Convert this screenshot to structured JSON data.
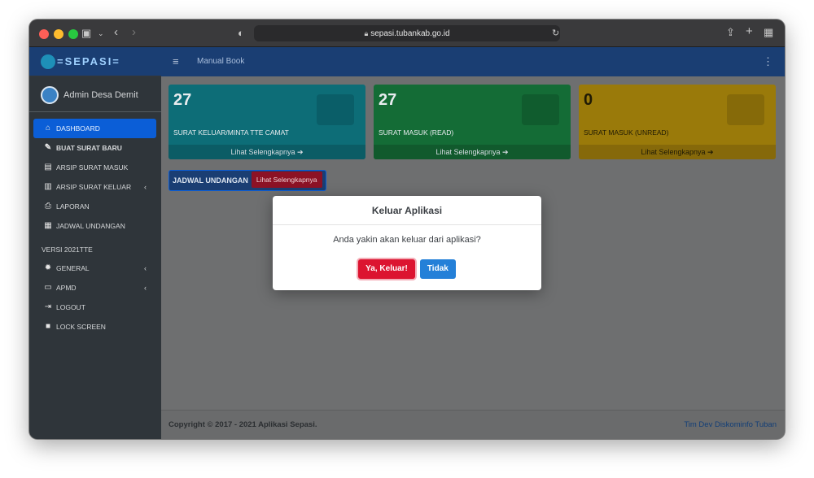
{
  "browser": {
    "url": "sepasi.tubankab.go.id"
  },
  "brand": {
    "name": "=SEPASI="
  },
  "user": {
    "name": "Admin Desa Demit"
  },
  "sidebar": {
    "items": [
      {
        "label": "DASHBOARD",
        "icon": "dashboard-icon",
        "active": true
      },
      {
        "label": "BUAT SURAT BARU",
        "icon": "compose-icon"
      },
      {
        "label": "ARSIP SURAT MASUK",
        "icon": "inbox-archive-icon"
      },
      {
        "label": "ARSIP SURAT KELUAR",
        "icon": "outbox-archive-icon",
        "chevron": "‹"
      },
      {
        "label": "LAPORAN",
        "icon": "printer-icon"
      },
      {
        "label": "JADWAL UNDANGAN",
        "icon": "calendar-icon"
      }
    ],
    "section_header": "VERSI 2021TTE",
    "items2": [
      {
        "label": "GENERAL",
        "icon": "gear-icon",
        "chevron": "‹"
      },
      {
        "label": "APMD",
        "icon": "id-card-icon",
        "chevron": "‹"
      },
      {
        "label": "LOGOUT",
        "icon": "logout-icon"
      },
      {
        "label": "LOCK SCREEN",
        "icon": "lock-icon"
      }
    ]
  },
  "topbar": {
    "title": "Manual Book"
  },
  "cards": [
    {
      "count": "27",
      "label": "SURAT KELUAR/MINTA TTE CAMAT",
      "link": "Lihat Selengkapnya ➔"
    },
    {
      "count": "27",
      "label": "SURAT MASUK (READ)",
      "link": "Lihat Selengkapnya ➔"
    },
    {
      "count": "0",
      "label": "SURAT MASUK (UNREAD)",
      "link": "Lihat Selengkapnya ➔"
    }
  ],
  "jadwal": {
    "label": "JADWAL UNDANGAN",
    "button": "Lihat Selengkapnya"
  },
  "modal": {
    "title": "Keluar Aplikasi",
    "message": "Anda yakin akan keluar dari aplikasi?",
    "confirm": "Ya, Keluar!",
    "cancel": "Tidak"
  },
  "footer": {
    "copyright": "Copyright © 2017 - 2021 Aplikasi Sepasi.",
    "dev": "Tim Dev Diskominfo Tuban"
  },
  "colors": {
    "navbar": "#1a3e73",
    "sidebar": "#2f353a",
    "active": "#0b5ed7",
    "danger": "#dc1430",
    "primary": "#2480d8"
  }
}
